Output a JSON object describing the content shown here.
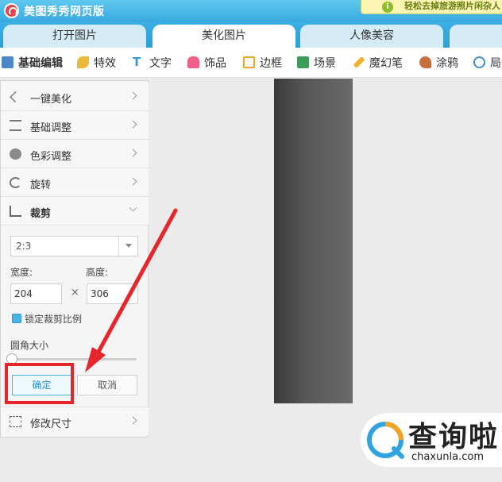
{
  "app": {
    "title": "美图秀秀网页版"
  },
  "promo": {
    "text": "轻松去掉旅游照片闲杂人",
    "icon": "info-icon"
  },
  "tabs": [
    {
      "label": "打开图片",
      "active": false
    },
    {
      "label": "美化图片",
      "active": true
    },
    {
      "label": "人像美容",
      "active": false
    }
  ],
  "toolbar": {
    "items": [
      "基础编辑",
      "特效",
      "文字",
      "饰品",
      "边框",
      "场景",
      "魔幻笔",
      "涂鸦",
      "局部"
    ],
    "active": "基础编辑"
  },
  "panel": {
    "menu": [
      "一键美化",
      "基础调整",
      "色彩调整",
      "旋转",
      "裁剪"
    ],
    "expanded": "裁剪",
    "crop": {
      "ratio": "2:3",
      "width_label": "宽度:",
      "width_value": "204",
      "times": "×",
      "height_label": "高度:",
      "height_value": "306",
      "lock_label": "锁定裁剪比例",
      "lock_checked": true,
      "radius_label": "圆角大小",
      "radius_value": 0,
      "confirm": "确定",
      "cancel": "取消"
    },
    "resize": "修改尺寸"
  },
  "watermark": {
    "text": "查询啦",
    "domain": "chaxunla.com"
  },
  "colors": {
    "accent": "#38a9df",
    "annotation": "#e8252b"
  }
}
